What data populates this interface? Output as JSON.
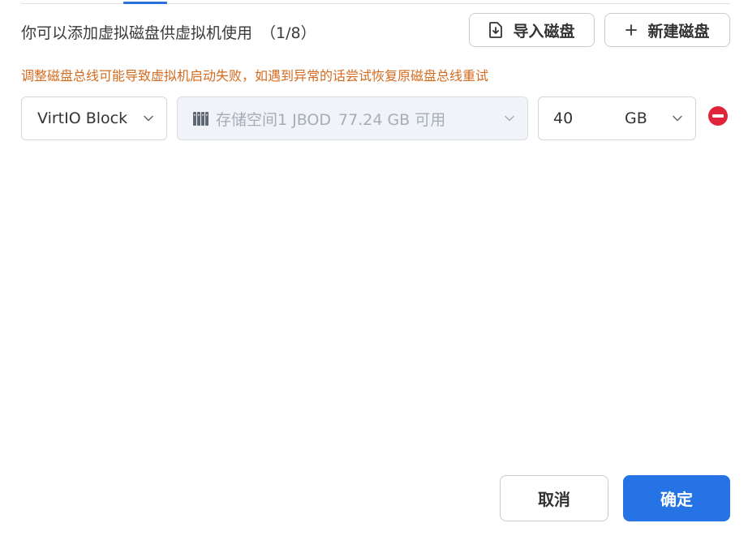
{
  "header": {
    "description": "你可以添加虚拟磁盘供虚拟机使用",
    "count": "（1/8）"
  },
  "toolbar": {
    "import_label": "导入磁盘",
    "new_label": "新建磁盘",
    "import_icon": "import-file-icon",
    "new_icon": "plus-icon"
  },
  "warning": {
    "text": "调整磁盘总线可能导致虚拟机启动失败，如遇到异常的话尝试恢复原磁盘总线重试",
    "color": "#d46b1e"
  },
  "disk": {
    "bus": "VirtIO Block",
    "storage_name": "存储空间1 JBOD",
    "storage_available": "77.24 GB 可用",
    "size": "40",
    "unit": "GB",
    "storage_icon": "storage-pool-icon",
    "remove_icon": "remove-circle-icon"
  },
  "footer": {
    "cancel_label": "取消",
    "ok_label": "确定"
  },
  "colors": {
    "accent": "#2573e4",
    "danger": "#e0253a"
  }
}
